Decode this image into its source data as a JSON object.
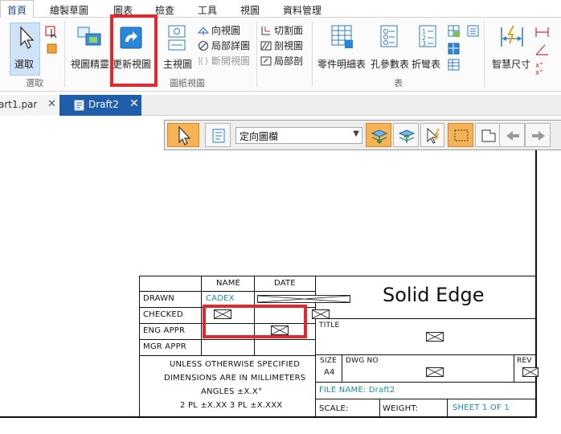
{
  "ribbon_tabs": [
    "首頁",
    "繪製草圖",
    "圖表",
    "檢查",
    "工具",
    "視圖",
    "資料管理"
  ],
  "ribbon": {
    "select_label": "選取",
    "select_group": "選取",
    "view_wizard_label": "視圖精靈",
    "update_views_label": "更新視圖",
    "main_view_label": "主視圖",
    "aux_view_label": "向視圖",
    "detail_view_label": "局部詳圖",
    "broken_view_label": "斷開視圖",
    "drawing_views_group": "圖紙視圖",
    "cutting_plane_label": "切割面",
    "section_view_label": "剖視圖",
    "broken_out_label": "局部剖",
    "parts_list_label": "零件明細表",
    "hole_table_label": "孔參數表",
    "bend_table_label": "折彎表",
    "tables_group": "表",
    "smart_dim_label": "智慧尺寸"
  },
  "document_tabs": {
    "tab1": "art1.par",
    "tab2": "Draft2",
    "close": "✕"
  },
  "command_bar": {
    "view_orientation": "定向圖欄"
  },
  "title_block": {
    "col_name": "NAME",
    "col_date": "DATE",
    "rows": [
      "DRAWN",
      "CHECKED",
      "ENG APPR",
      "MGR APPR"
    ],
    "drawn_name": "CADEX",
    "company": "Solid Edge",
    "title_label": "TITLE",
    "note_1": "UNLESS OTHERWISE SPECIFIED",
    "note_2": "DIMENSIONS ARE IN MILLIMETERS",
    "note_3": "ANGLES ±X.X°",
    "note_4": "2 PL ±X.XX 3 PL ±X.XXX",
    "size_label": "SIZE",
    "size_value": "A4",
    "dwg_no_label": "DWG NO",
    "rev_label": "REV",
    "file_name": "FILE NAME: Draft2",
    "scale_label": "SCALE:",
    "weight_label": "WEIGHT:",
    "sheet_label": "SHEET 1 OF 1"
  },
  "colors": {
    "accent_blue": "#1f5ea8",
    "highlight_red": "#e0282e",
    "field_cyan": "#1a8f9a",
    "active_button": "#f5b356"
  }
}
